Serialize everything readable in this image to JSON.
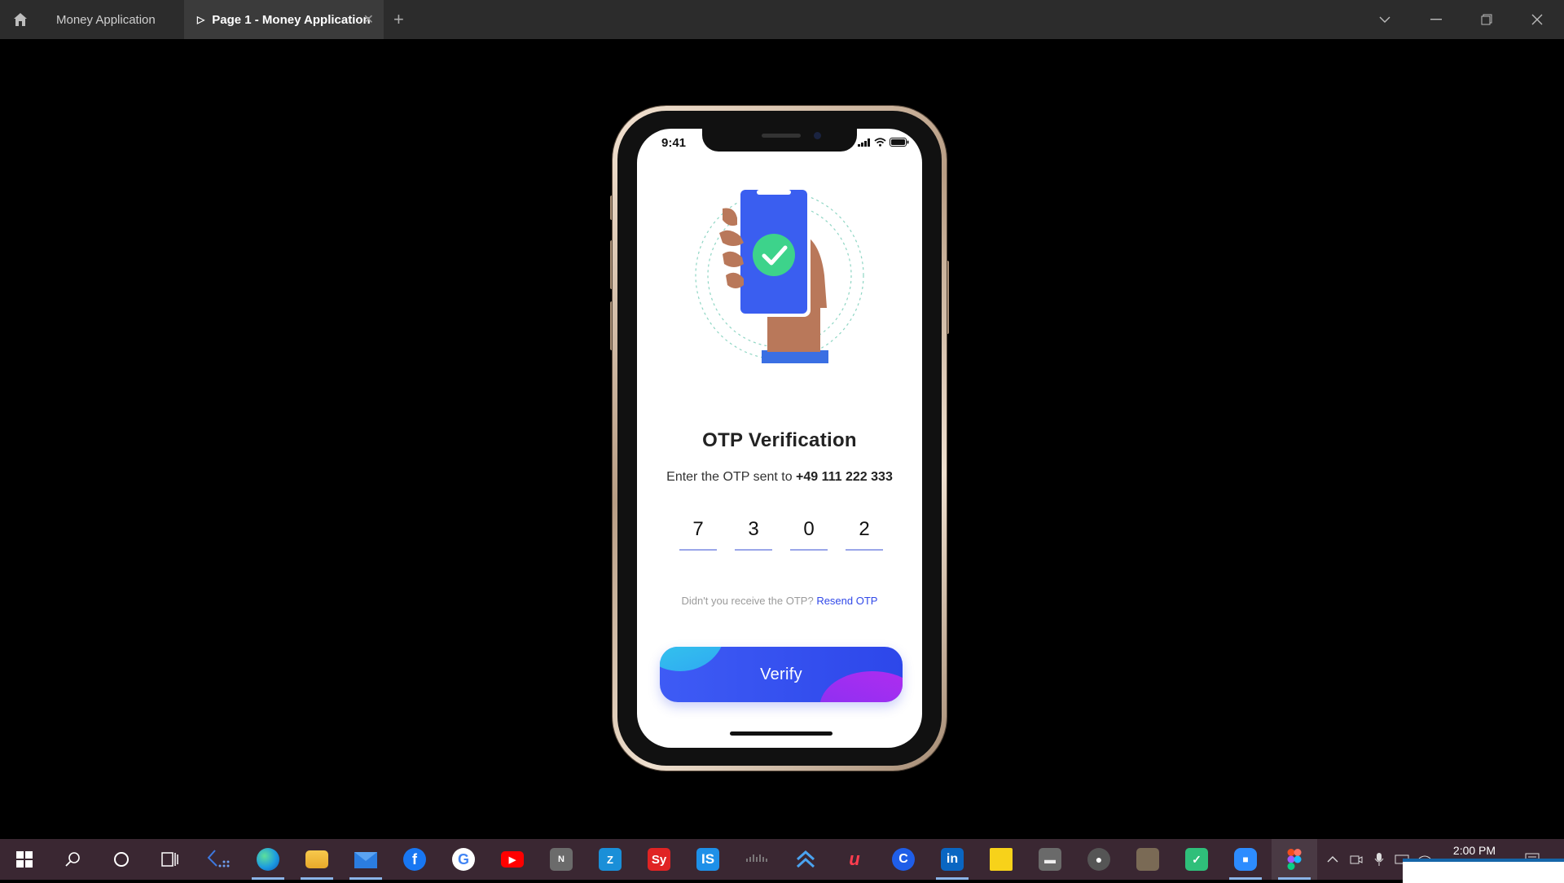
{
  "window": {
    "tabs": [
      {
        "label": "Money Application",
        "active": false
      },
      {
        "label": "Page 1 - Money Application",
        "active": true
      }
    ],
    "new_tab": "+"
  },
  "phone": {
    "status_time": "9:41",
    "title": "OTP Verification",
    "subtitle_prefix": "Enter the OTP sent to ",
    "phone_number": "+49 111 222 333",
    "otp_digits": [
      "7",
      "3",
      "0",
      "2"
    ],
    "resend_prompt": "Didn't you receive the OTP? ",
    "resend_link": "Resend OTP",
    "verify_label": "Verify",
    "colors": {
      "accent": "#3048e8",
      "button_start": "#3e5bf5",
      "check_green": "#3dd38b",
      "skin": "#b9785a"
    }
  },
  "taskbar": {
    "apps": [
      "start",
      "search",
      "cortana",
      "task-view",
      "dots-app",
      "edge",
      "file-explorer",
      "mail",
      "facebook",
      "google",
      "youtube",
      "notion",
      "zoho",
      "sy-app",
      "is-app",
      "cisco",
      "arrow-app",
      "u-app",
      "c-app",
      "linkedin",
      "sticky-notes",
      "drive-app",
      "github",
      "photo-app",
      "shield-app",
      "zoom",
      "figma"
    ],
    "clock": "2:00 PM"
  }
}
